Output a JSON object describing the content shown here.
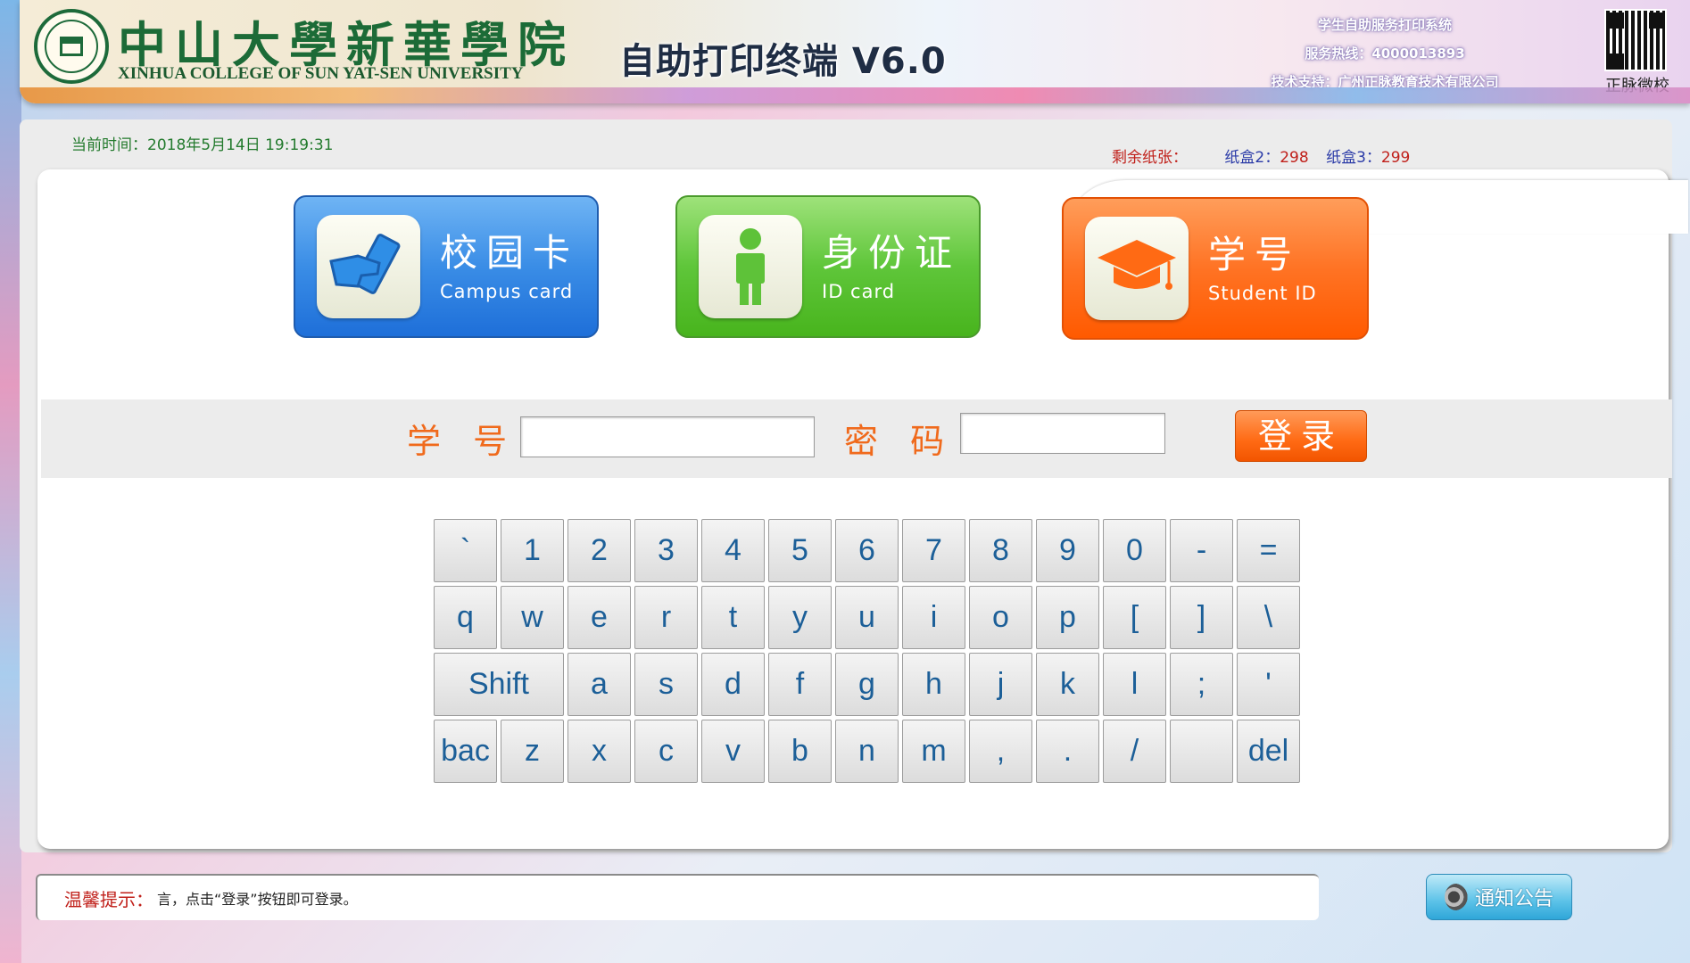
{
  "header": {
    "college_name_cn": "中山大學新華學院",
    "college_name_en": "XINHUA COLLEGE OF SUN YAT-SEN UNIVERSITY",
    "app_title": "自助打印终端 V6.0",
    "system_name": "学生自助服务打印系统",
    "hotline": "服务热线：4000013893",
    "tech_support": "技术支持：广州正脉教育技术有限公司",
    "qr_label": "正脉微校"
  },
  "status": {
    "datetime": "当前时间：2018年5月14日 19:19:31",
    "paper_label": "剩余纸张：",
    "tray2_label": "纸盒2：",
    "tray2_value": "298",
    "tray3_label": "纸盒3：",
    "tray3_value": "299"
  },
  "login_methods": [
    {
      "label_cn": "校园卡",
      "label_en": "Campus card",
      "icon": "campus-card-icon"
    },
    {
      "label_cn": "身份证",
      "label_en": "ID card",
      "icon": "person-icon"
    },
    {
      "label_cn": "学号",
      "label_en": "Student ID",
      "icon": "graduation-cap-icon"
    }
  ],
  "login_form": {
    "student_id_label": "学 号：",
    "student_id_value": "",
    "password_label": "密 码：",
    "password_value": "",
    "login_button": "登录"
  },
  "keyboard": {
    "rows": [
      [
        "`",
        "1",
        "2",
        "3",
        "4",
        "5",
        "6",
        "7",
        "8",
        "9",
        "0",
        "-",
        "="
      ],
      [
        "q",
        "w",
        "e",
        "r",
        "t",
        "y",
        "u",
        "i",
        "o",
        "p",
        "[",
        "]",
        "\\"
      ],
      [
        "Shift",
        "a",
        "s",
        "d",
        "f",
        "g",
        "h",
        "j",
        "k",
        "l",
        ";",
        "'"
      ],
      [
        "bac",
        "z",
        "x",
        "c",
        "v",
        "b",
        "n",
        "m",
        ",",
        ".",
        "/",
        "",
        "del"
      ]
    ]
  },
  "notice": {
    "label": "温馨提示：",
    "message": "言，点击“登录”按钮即可登录。",
    "button": "通知公告"
  },
  "colors": {
    "accent_orange": "#f06a1c",
    "key_text": "#1c5f98",
    "status_red": "#c0201a",
    "status_blue": "#2a3aa7",
    "datetime_green": "#237a2d"
  }
}
